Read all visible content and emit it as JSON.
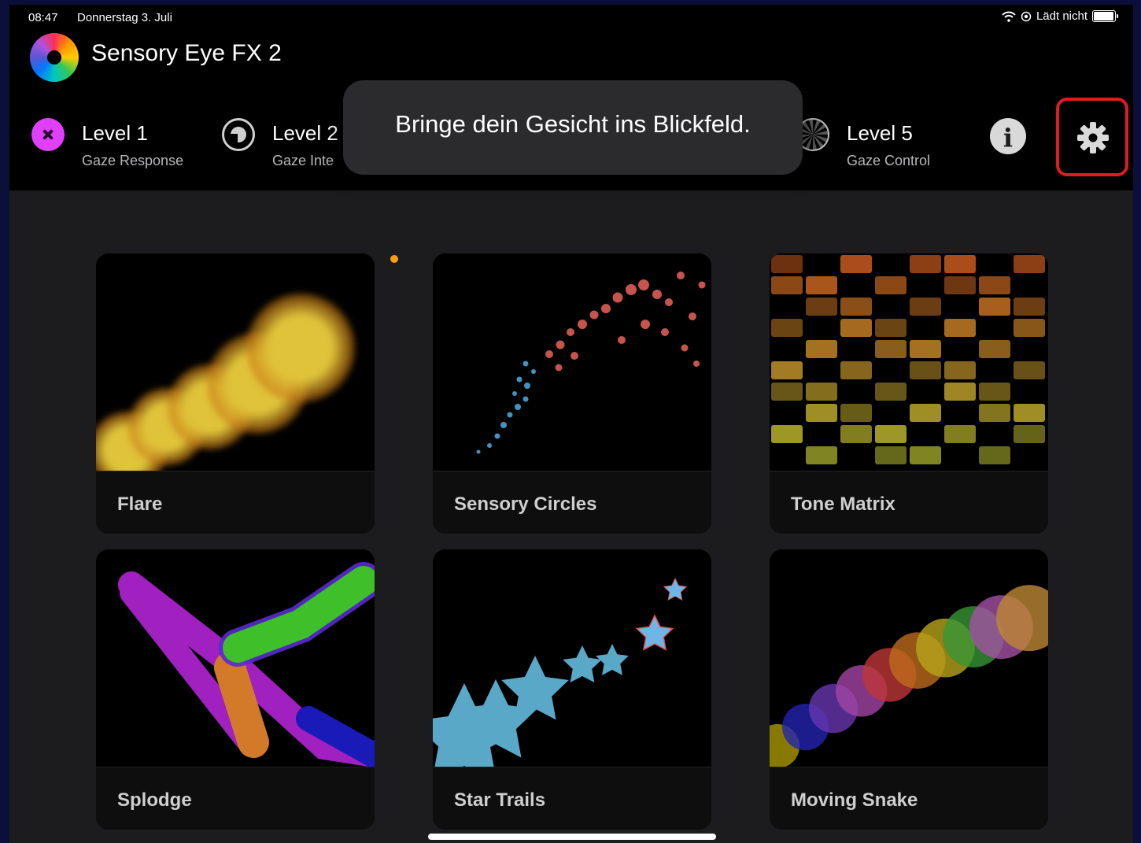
{
  "status": {
    "time": "08:47",
    "date": "Donnerstag 3. Juli",
    "battery_text": "Lädt nicht"
  },
  "app": {
    "title": "Sensory Eye FX 2"
  },
  "levels": [
    {
      "title": "Level 1",
      "subtitle": "Gaze Response"
    },
    {
      "title": "Level 2",
      "subtitle": "Gaze Inte"
    },
    {
      "title": "Level 5",
      "subtitle": "Gaze Control"
    }
  ],
  "toast": {
    "message": "Bringe dein Gesicht ins Blickfeld."
  },
  "info": {
    "glyph": "i"
  },
  "activities": [
    {
      "name": "Flare"
    },
    {
      "name": "Sensory Circles"
    },
    {
      "name": "Tone Matrix"
    },
    {
      "name": "Splodge"
    },
    {
      "name": "Star Trails"
    },
    {
      "name": "Moving Snake"
    }
  ]
}
